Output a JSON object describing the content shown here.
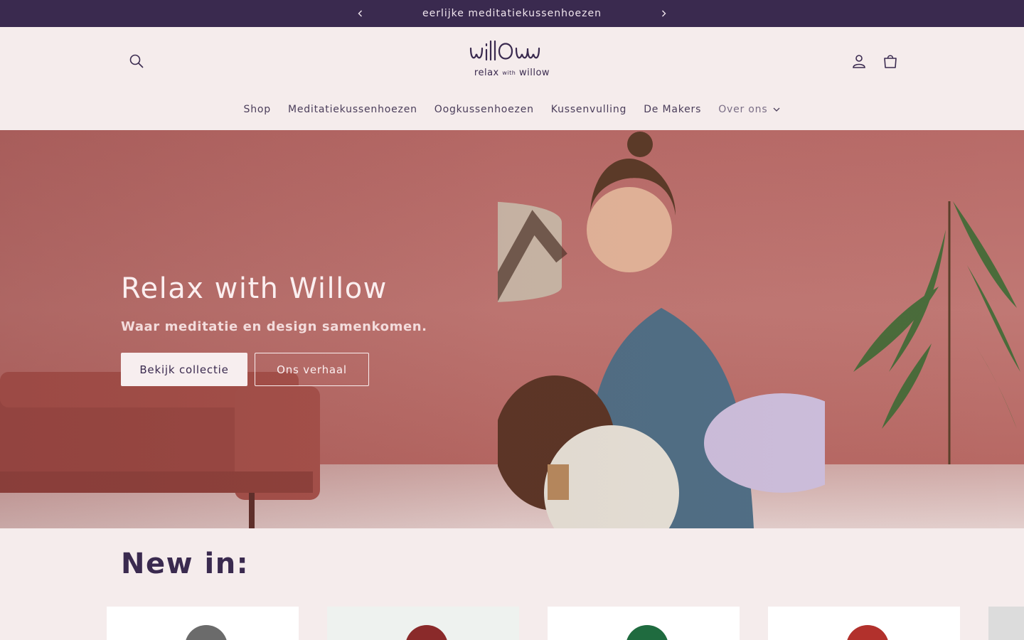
{
  "announcement": {
    "text": "eerlijke meditatiekussenhoezen",
    "prev_icon": "chevron-left-icon",
    "next_icon": "chevron-right-icon"
  },
  "header": {
    "logo_wordmark": "willow",
    "logo_tagline_main": "relax",
    "logo_tagline_small": "with",
    "logo_tagline_end": "willow",
    "icons": [
      "search-icon",
      "account-icon",
      "cart-icon"
    ]
  },
  "nav": {
    "items": [
      {
        "label": "Shop"
      },
      {
        "label": "Meditatiekussenhoezen"
      },
      {
        "label": "Oogkussenhoezen"
      },
      {
        "label": "Kussenvulling"
      },
      {
        "label": "De Makers"
      },
      {
        "label": "Over ons"
      }
    ]
  },
  "hero": {
    "title": "Relax with Willow",
    "subtitle": "Waar meditatie en design samenkomen.",
    "primary_button": "Bekijk collectie",
    "secondary_button": "Ons verhaal"
  },
  "new_in": {
    "title": "New in:",
    "products": [
      {
        "color": "#6b6b6b"
      },
      {
        "color": "#8a2a2a"
      },
      {
        "color": "#1f6b3f"
      },
      {
        "color": "#b2312c"
      }
    ]
  },
  "colors": {
    "announcement_bg": "#3a2a4f",
    "page_bg": "#f5ecec",
    "brand_text": "#3a2a4f"
  }
}
